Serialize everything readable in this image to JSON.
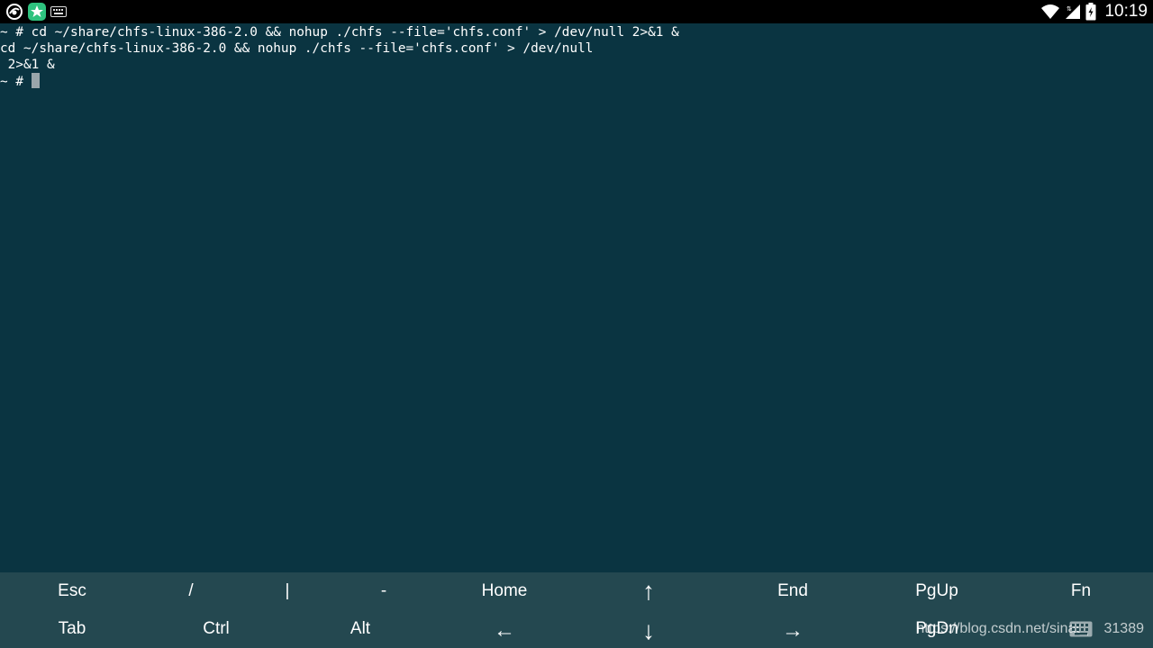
{
  "status_bar": {
    "left_icons": [
      "vpn-icon",
      "app-store-icon",
      "keyboard-icon"
    ],
    "right_icons": [
      "wifi-icon",
      "signal-icon",
      "battery-icon"
    ],
    "time": "10:19"
  },
  "terminal": {
    "lines": [
      "~ # cd ~/share/chfs-linux-386-2.0 && nohup ./chfs --file='chfs.conf' > /dev/null 2>&1 &",
      "cd ~/share/chfs-linux-386-2.0 && nohup ./chfs --file='chfs.conf' > /dev/null",
      " 2>&1 &"
    ],
    "prompt": "~ # "
  },
  "extra_keys": {
    "row1": [
      "Esc",
      "/",
      "|",
      "-",
      "Home",
      "↑",
      "End",
      "PgUp",
      "Fn"
    ],
    "row2": [
      "Tab",
      "Ctrl",
      "Alt",
      "←",
      "↓",
      "→",
      "PgDn"
    ]
  },
  "watermark": "https://blog.csdn.net/sinat_    31389"
}
